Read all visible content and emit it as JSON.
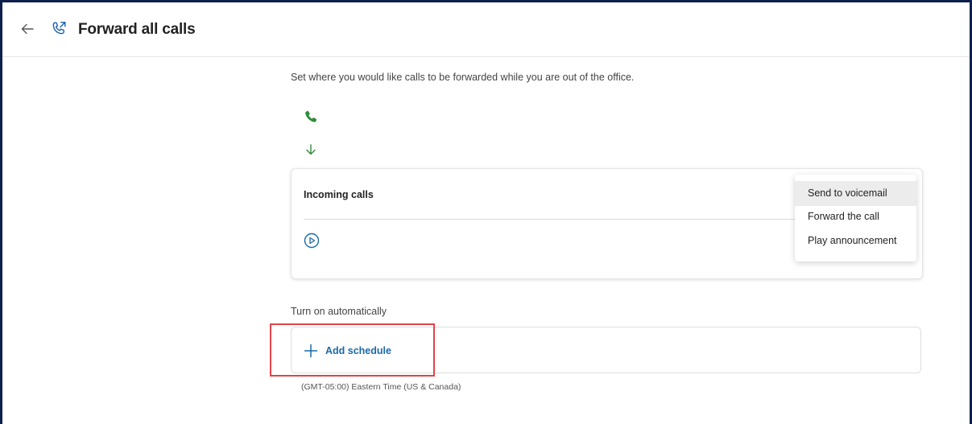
{
  "header": {
    "title": "Forward all calls",
    "back_icon": "arrow-left-icon",
    "title_icon": "phone-forward-icon"
  },
  "main": {
    "description": "Set where you would like calls to be forwarded while you are out of the office.",
    "incoming_card": {
      "label": "Incoming calls",
      "play_icon": "play-circle-icon"
    },
    "dropdown": {
      "options": [
        "Send to voicemail",
        "Forward the call",
        "Play announcement"
      ],
      "highlighted": "Send to voicemail"
    },
    "auto_section": {
      "label": "Turn on automatically",
      "add_schedule_label": "Add schedule",
      "timezone": "(GMT-05:00) Eastern Time (US & Canada)"
    }
  },
  "colors": {
    "frame": "#0d1f4c",
    "accent_green": "#2e8b3a",
    "link_blue": "#1a6aa9",
    "annotation_red": "#e0444a"
  }
}
